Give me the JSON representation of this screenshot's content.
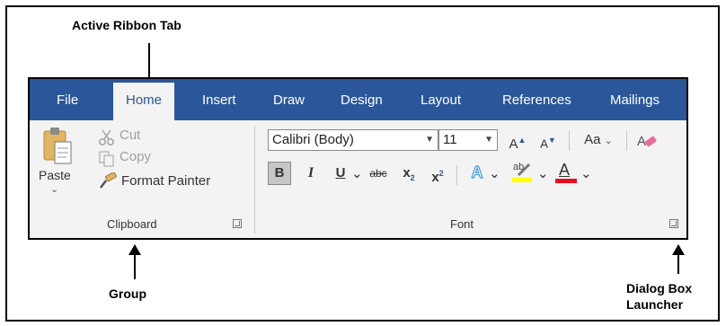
{
  "captions": {
    "active_ribbon_tab": "Active Ribbon Tab",
    "group": "Group",
    "dialog_box_launcher": "Dialog Box Launcher"
  },
  "tabs": [
    "File",
    "Home",
    "Insert",
    "Draw",
    "Design",
    "Layout",
    "References",
    "Mailings"
  ],
  "active_tab": "Home",
  "clipboard": {
    "paste_label": "Paste",
    "paste_dropdown": "⌄",
    "cut_label": "Cut",
    "copy_label": "Copy",
    "format_painter_label": "Format Painter",
    "group_label": "Clipboard"
  },
  "font": {
    "font_name": "Calibri (Body)",
    "font_size": "11",
    "grow_font": "A",
    "shrink_font": "A",
    "change_case": "Aa",
    "bold": "B",
    "italic": "I",
    "underline": "U",
    "strikethrough": "abc",
    "subscript": "x",
    "superscript": "x",
    "subscript_mark": "2",
    "superscript_mark": "2",
    "text_effects": "A",
    "highlight": "ab",
    "font_color": "A",
    "group_label": "Font"
  },
  "colors": {
    "tab_bar": "#2b579a",
    "ribbon_bg": "#f3f3f3",
    "highlight_yellow": "#ffff00",
    "font_color_red": "#e81123",
    "text_effects_blue": "#2b88d8"
  }
}
